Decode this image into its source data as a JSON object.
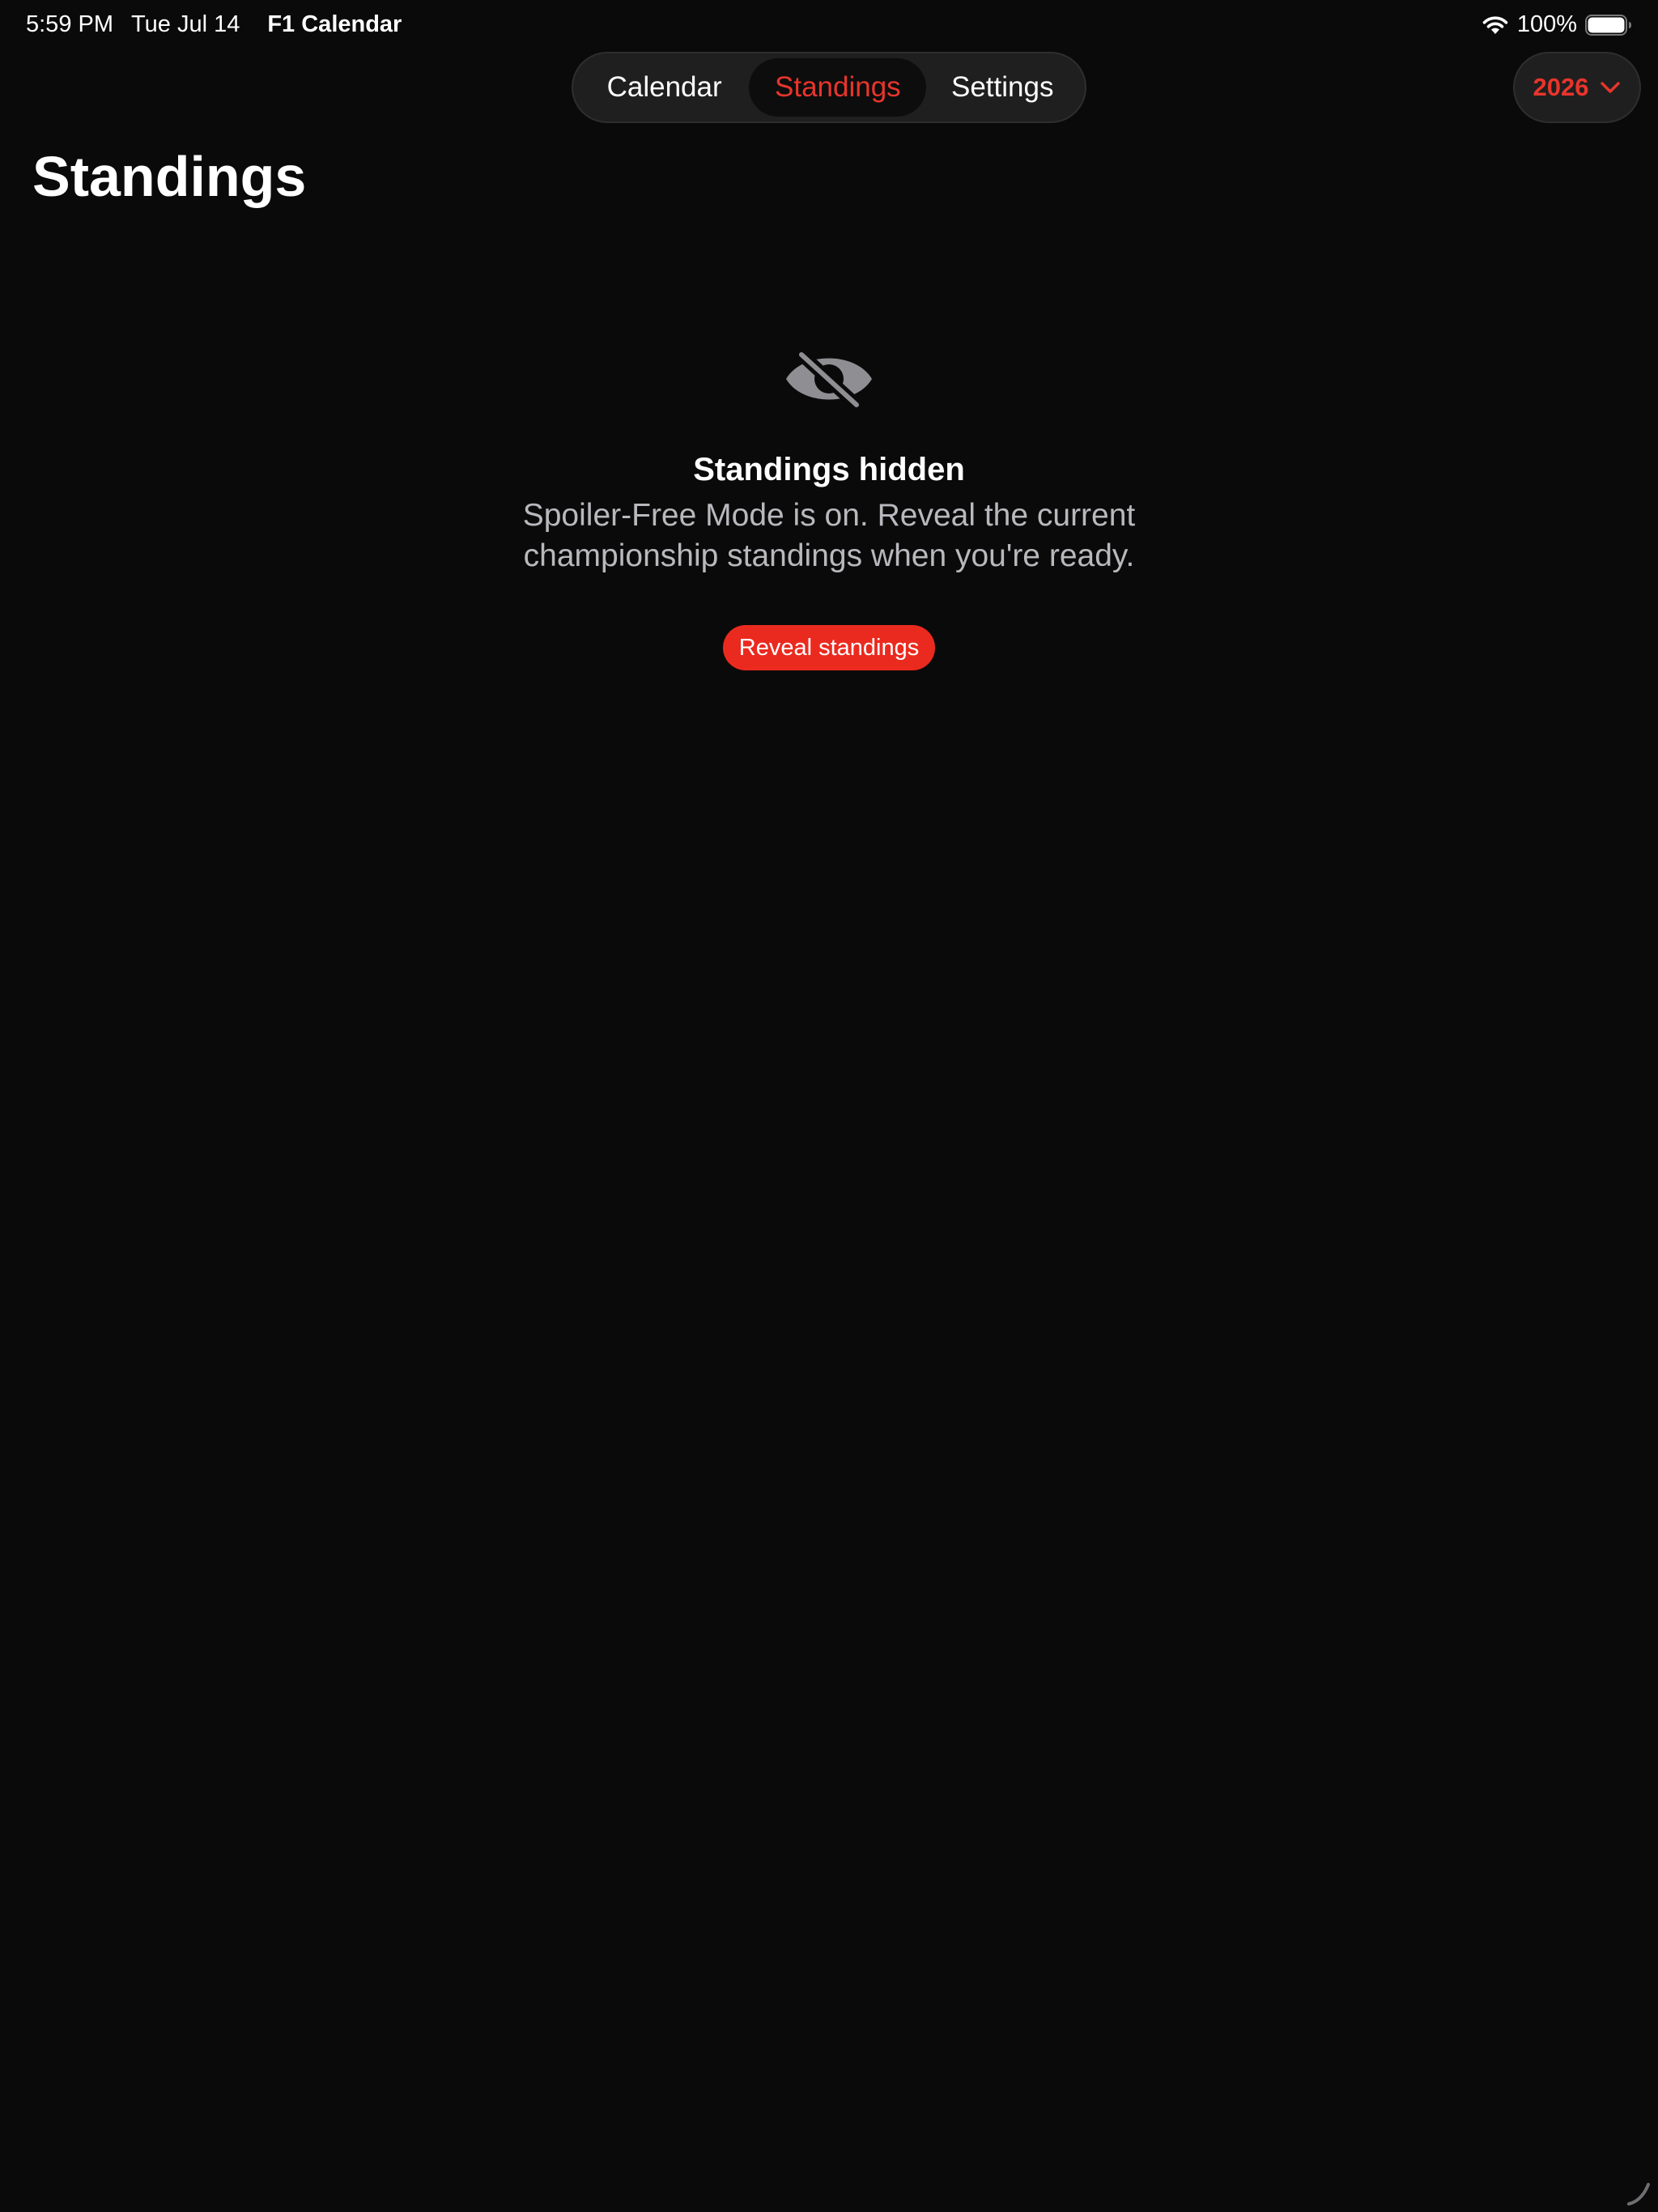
{
  "status_bar": {
    "time": "5:59 PM",
    "date": "Tue Jul 14",
    "app_name": "F1 Calendar",
    "battery_percent": "100%",
    "battery_level": 1.0
  },
  "nav": {
    "tabs": [
      {
        "label": "Calendar",
        "selected": false
      },
      {
        "label": "Standings",
        "selected": true
      },
      {
        "label": "Settings",
        "selected": false
      }
    ]
  },
  "year_picker": {
    "value": "2026"
  },
  "page": {
    "title": "Standings"
  },
  "empty_state": {
    "icon": "eye-slash-icon",
    "title": "Standings hidden",
    "message": "Spoiler-Free Mode is on. Reveal the current championship standings when you're ready.",
    "button_label": "Reveal standings"
  },
  "colors": {
    "background": "#0a0a0a",
    "accent": "#e8352c",
    "button": "#eb2a1f",
    "secondary_text": "#b8b8bd",
    "icon_gray": "#8e8e93"
  }
}
